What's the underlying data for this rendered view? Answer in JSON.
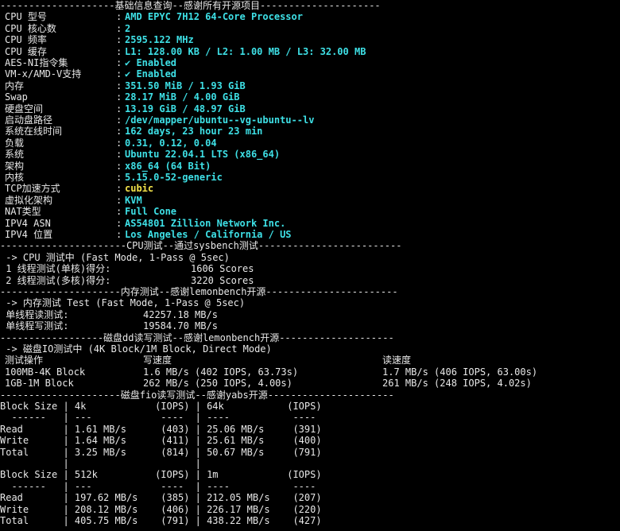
{
  "basic": {
    "header": "--------------------基础信息查询--感谢所有开源项目---------------------",
    "rows": [
      {
        "label": "CPU 型号",
        "value": "AMD EPYC 7H12 64-Core Processor"
      },
      {
        "label": "CPU 核心数",
        "value": "2"
      },
      {
        "label": "CPU 频率",
        "value": "2595.122 MHz"
      },
      {
        "label": "CPU 缓存",
        "value": "L1: 128.00 KB / L2: 1.00 MB / L3: 32.00 MB"
      },
      {
        "label": "AES-NI指令集",
        "value": "✔ Enabled"
      },
      {
        "label": "VM-x/AMD-V支持",
        "value": "✔ Enabled"
      },
      {
        "label": "内存",
        "value": "351.50 MiB / 1.93 GiB"
      },
      {
        "label": "Swap",
        "value": "28.17 MiB / 4.00 GiB"
      },
      {
        "label": "硬盘空间",
        "value": "13.19 GiB / 48.97 GiB"
      },
      {
        "label": "启动盘路径",
        "value": "/dev/mapper/ubuntu--vg-ubuntu--lv"
      },
      {
        "label": "系统在线时间",
        "value": "162 days, 23 hour 23 min"
      },
      {
        "label": "负载",
        "value": "0.31, 0.12, 0.04"
      },
      {
        "label": "系统",
        "value": "Ubuntu 22.04.1 LTS (x86_64)"
      },
      {
        "label": "架构",
        "value": "x86_64 (64 Bit)"
      },
      {
        "label": "内核",
        "value": "5.15.0-52-generic"
      },
      {
        "label": "TCP加速方式",
        "value": "cubic"
      },
      {
        "label": "虚拟化架构",
        "value": "KVM"
      },
      {
        "label": "NAT类型",
        "value": "Full Cone"
      },
      {
        "label": "IPV4 ASN",
        "value": "AS54801 Zillion Network Inc."
      },
      {
        "label": "IPV4 位置",
        "value": "Los Angeles / California / US"
      }
    ]
  },
  "cpu": {
    "header": "----------------------CPU测试--通过sysbench测试-------------------------",
    "mode": " -> CPU 测试中 (Fast Mode, 1-Pass @ 5sec)",
    "single_label": " 1 线程测试(单核)得分:",
    "single_value": "1606 Scores",
    "multi_label": " 2 线程测试(多核)得分:",
    "multi_value": "3220 Scores"
  },
  "memory": {
    "header": "---------------------内存测试--感谢lemonbench开源-----------------------",
    "mode": " -> 内存测试 Test (Fast Mode, 1-Pass @ 5sec)",
    "read_label": " 单线程读测试:",
    "read_value": "42257.18 MB/s",
    "write_label": " 单线程写测试:",
    "write_value": "19584.70 MB/s"
  },
  "disk_dd": {
    "header": "------------------磁盘dd读写测试--感谢lemonbench开源--------------------",
    "mode": " -> 磁盘IO测试中 (4K Block/1M Block, Direct Mode)",
    "columns": [
      "测试操作",
      "写速度",
      "读速度"
    ],
    "rows": [
      {
        "op": "100MB-4K Block",
        "write": "1.6 MB/s (402 IOPS, 63.73s)",
        "read": "1.7 MB/s (406 IOPS, 63.00s)"
      },
      {
        "op": "1GB-1M Block",
        "write": "262 MB/s (250 IOPS, 4.00s)",
        "read": "261 MB/s (248 IOPS, 4.02s)"
      }
    ]
  },
  "fio": {
    "header": "---------------------磁盘fio读写测试--感谢yabs开源----------------------",
    "lines": [
      "Block Size | 4k            (IOPS) | 64k           (IOPS)",
      "  ------   | ---            ----  | ----           ----",
      "Read       | 1.61 MB/s      (403) | 25.06 MB/s     (391)",
      "Write      | 1.64 MB/s      (411) | 25.61 MB/s     (400)",
      "Total      | 3.25 MB/s      (814) | 50.67 MB/s     (791)",
      "           |                      |",
      "Block Size | 512k          (IOPS) | 1m            (IOPS)",
      "  ------   | ---            ----  | ----           ----",
      "Read       | 197.62 MB/s    (385) | 212.05 MB/s    (207)",
      "Write      | 208.12 MB/s    (406) | 226.17 MB/s    (220)",
      "Total      | 405.75 MB/s    (791) | 438.22 MB/s    (427)"
    ]
  },
  "colors": {
    "background": "#000000",
    "text": "#e8e8e8",
    "value": "#3ee0e6",
    "highlight": "#f2e24a"
  }
}
